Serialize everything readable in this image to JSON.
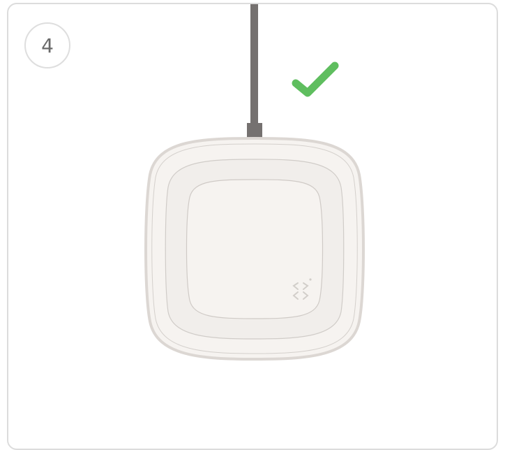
{
  "step": {
    "number": "4"
  },
  "colors": {
    "check": "#5fbe5f",
    "cable": "#757170",
    "pad_fill": "#f6f3f0",
    "pad_stroke": "#dcd7d3",
    "card_border": "#dcdcdc"
  },
  "icons": {
    "status": "checkmark-icon",
    "logo": "pad-logo-icon"
  }
}
